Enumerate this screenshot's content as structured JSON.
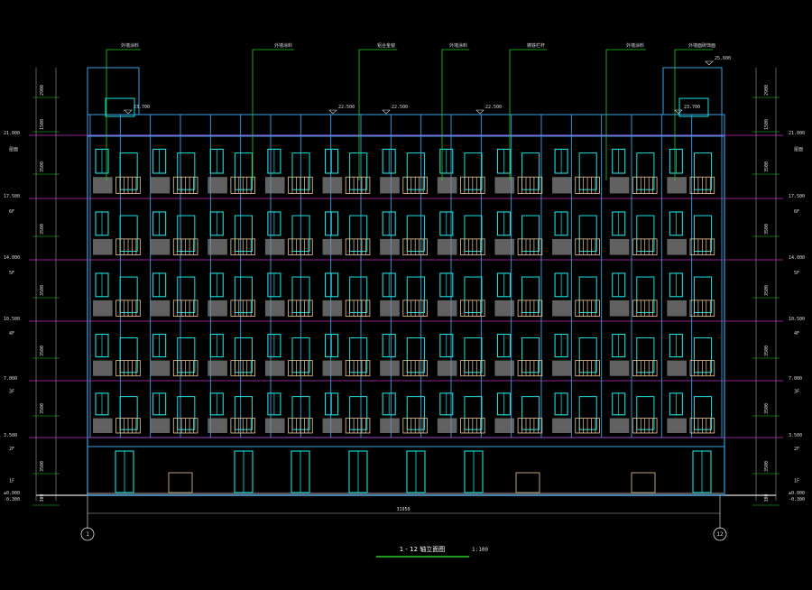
{
  "drawing": {
    "title": "1 - 12 轴立面图",
    "scale": "1:100",
    "total_dimension": "31950",
    "axis_left": "1",
    "axis_right": "12"
  },
  "callouts": [
    "外墙涂料",
    "外墙涂料",
    "铝合金窗",
    "外墙涂料",
    "铸铁栏杆",
    "外墙涂料",
    "外墙面砖饰面"
  ],
  "top_elevations": [
    "25.600",
    "23.700",
    "22.500",
    "22.500",
    "22.500",
    "23.700"
  ],
  "floor_levels": [
    "21.000",
    "17.500",
    "14.000",
    "10.500",
    "7.000",
    "3.500",
    "±0.000",
    "-0.300"
  ],
  "floor_names": [
    "屋面",
    "6F",
    "5F",
    "4F",
    "3F",
    "2F",
    "1F"
  ],
  "left_dims": [
    "2900",
    "1500",
    "3500",
    "3500",
    "3500",
    "3500",
    "3500",
    "3500",
    "300"
  ],
  "colors": {
    "background": "#000000",
    "wall": "#3aa0e6",
    "window": "#19e0e0",
    "balcony_rail": "#e8c89a",
    "level_line": "#c030c0",
    "callout_line": "#22cc22",
    "dimension": "#bbbbbb"
  }
}
